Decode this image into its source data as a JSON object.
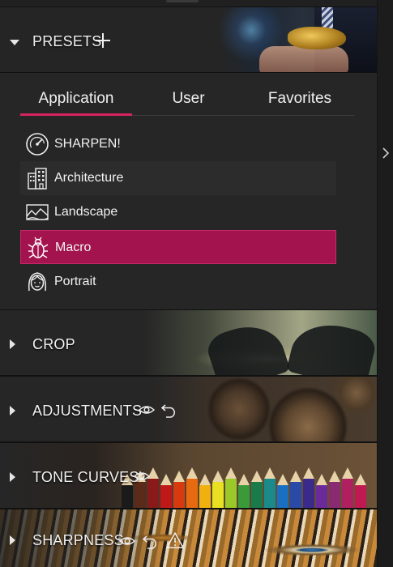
{
  "presets": {
    "title": "PRESETS",
    "tabs": [
      {
        "label": "Application",
        "active": true
      },
      {
        "label": "User",
        "active": false
      },
      {
        "label": "Favorites",
        "active": false
      }
    ],
    "items": [
      {
        "label": "SHARPEN!",
        "icon": "gauge-icon"
      },
      {
        "label": "Architecture",
        "icon": "building-icon"
      },
      {
        "label": "Landscape",
        "icon": "landscape-icon"
      },
      {
        "label": "Macro",
        "icon": "bug-icon",
        "selected": true
      },
      {
        "label": "Portrait",
        "icon": "face-icon"
      }
    ]
  },
  "sections": {
    "crop": {
      "title": "CROP"
    },
    "adjustments": {
      "title": "ADJUSTMENTS"
    },
    "tone_curves": {
      "title": "TONE CURVES"
    },
    "sharpness": {
      "title": "SHARPNESS"
    }
  },
  "colors": {
    "accent": "#d6245f",
    "selected_bg": "#a3144e",
    "panel_bg": "#262626"
  }
}
